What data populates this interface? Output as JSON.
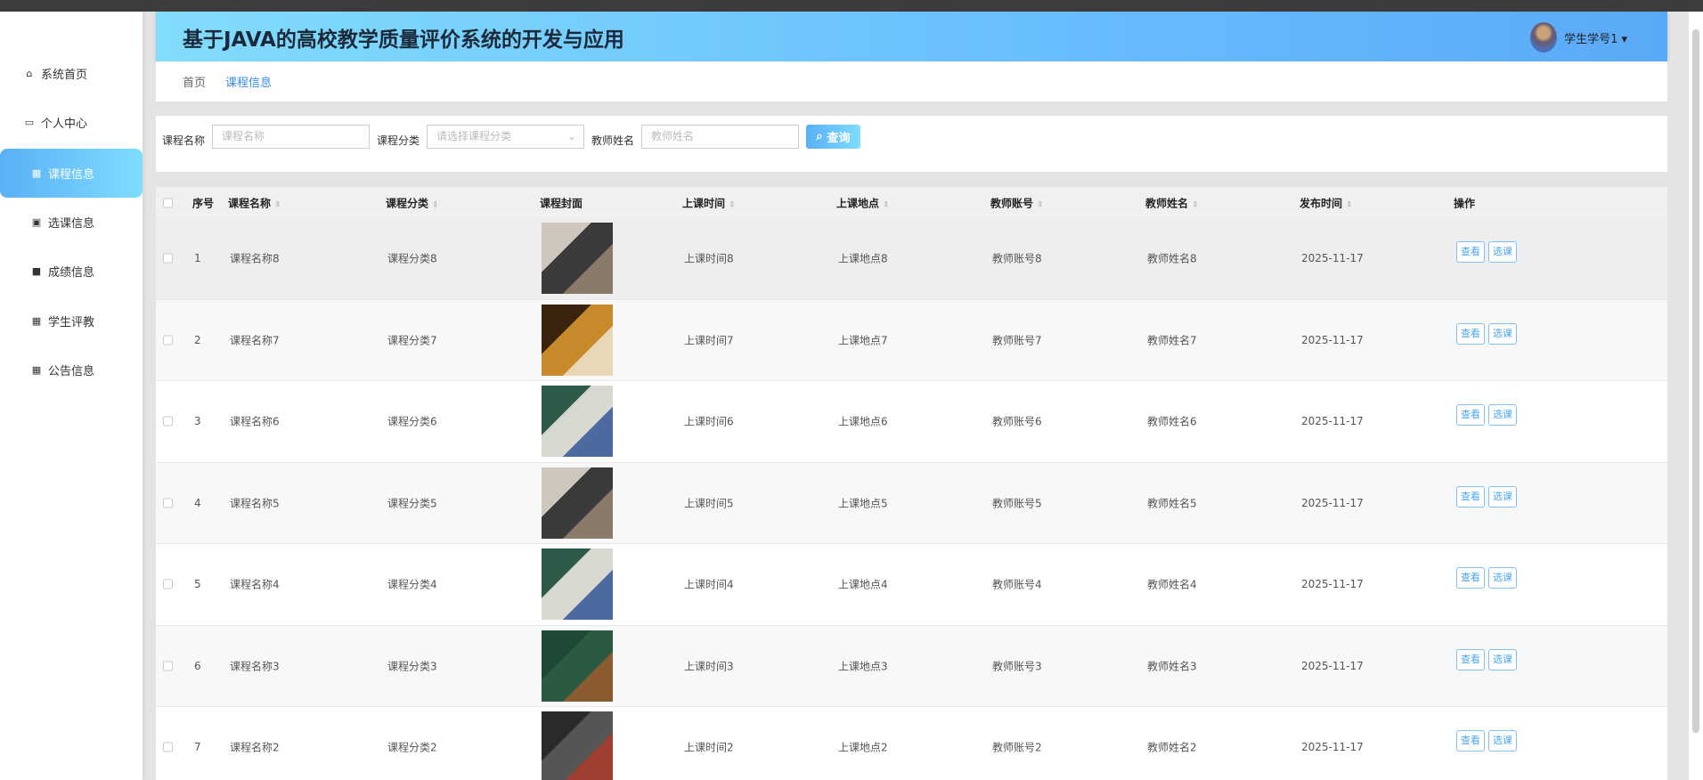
{
  "header": {
    "title": "基于JAVA的高校教学质量评价系统的开发与应用",
    "user": "学生学号1 ▾"
  },
  "sidebar": {
    "items": [
      {
        "label": "系统首页",
        "icon": "home-icon"
      },
      {
        "label": "个人中心",
        "icon": "profile-icon"
      },
      {
        "label": "课程信息",
        "icon": "grid-icon"
      },
      {
        "label": "选课信息",
        "icon": "clipboard-icon"
      },
      {
        "label": "成绩信息",
        "icon": "briefcase-icon"
      },
      {
        "label": "学生评教",
        "icon": "grid-icon"
      },
      {
        "label": "公告信息",
        "icon": "grid-icon"
      }
    ]
  },
  "breadcrumb": [
    "首页",
    "课程信息"
  ],
  "search": {
    "name_label": "课程名称",
    "name_placeholder": "课程名称",
    "category_label": "课程分类",
    "category_placeholder": "请选择课程分类",
    "teacher_label": "教师姓名",
    "teacher_placeholder": "教师姓名",
    "button": "查询"
  },
  "table": {
    "headers": [
      "序号",
      "课程名称",
      "课程分类",
      "课程封面",
      "上课时间",
      "上课地点",
      "教师账号",
      "教师姓名",
      "发布时间",
      "操作"
    ],
    "view_label": "查看",
    "select_label": "选课",
    "rows": [
      {
        "no": "1",
        "name": "课程名称8",
        "category": "课程分类8",
        "time": "上课时间8",
        "place": "上课地点8",
        "account": "教师账号8",
        "teacher": "教师姓名8",
        "date": "2025-11-17",
        "cover": [
          "#cfc7bd",
          "#3a3a3a",
          "#8a7a6a"
        ]
      },
      {
        "no": "2",
        "name": "课程名称7",
        "category": "课程分类7",
        "time": "上课时间7",
        "place": "上课地点7",
        "account": "教师账号7",
        "teacher": "教师姓名7",
        "date": "2025-11-17",
        "cover": [
          "#3a2410",
          "#c88a2a",
          "#e8d8b8"
        ]
      },
      {
        "no": "3",
        "name": "课程名称6",
        "category": "课程分类6",
        "time": "上课时间6",
        "place": "上课地点6",
        "account": "教师账号6",
        "teacher": "教师姓名6",
        "date": "2025-11-17",
        "cover": [
          "#2e5a4a",
          "#d8d8d0",
          "#4a6aa0"
        ]
      },
      {
        "no": "4",
        "name": "课程名称5",
        "category": "课程分类5",
        "time": "上课时间5",
        "place": "上课地点5",
        "account": "教师账号5",
        "teacher": "教师姓名5",
        "date": "2025-11-17",
        "cover": [
          "#cfc7bd",
          "#3a3a3a",
          "#8a7a6a"
        ]
      },
      {
        "no": "5",
        "name": "课程名称4",
        "category": "课程分类4",
        "time": "上课时间4",
        "place": "上课地点4",
        "account": "教师账号4",
        "teacher": "教师姓名4",
        "date": "2025-11-17",
        "cover": [
          "#2e5a4a",
          "#d8d8d0",
          "#4a6aa0"
        ]
      },
      {
        "no": "6",
        "name": "课程名称3",
        "category": "课程分类3",
        "time": "上课时间3",
        "place": "上课地点3",
        "account": "教师账号3",
        "teacher": "教师姓名3",
        "date": "2025-11-17",
        "cover": [
          "#1f4a35",
          "#2a5a40",
          "#8a5a30"
        ]
      },
      {
        "no": "7",
        "name": "课程名称2",
        "category": "课程分类2",
        "time": "上课时间2",
        "place": "上课地点2",
        "account": "教师账号2",
        "teacher": "教师姓名2",
        "date": "2025-11-17",
        "cover": [
          "#2a2a2a",
          "#555",
          "#a04030"
        ]
      }
    ]
  }
}
